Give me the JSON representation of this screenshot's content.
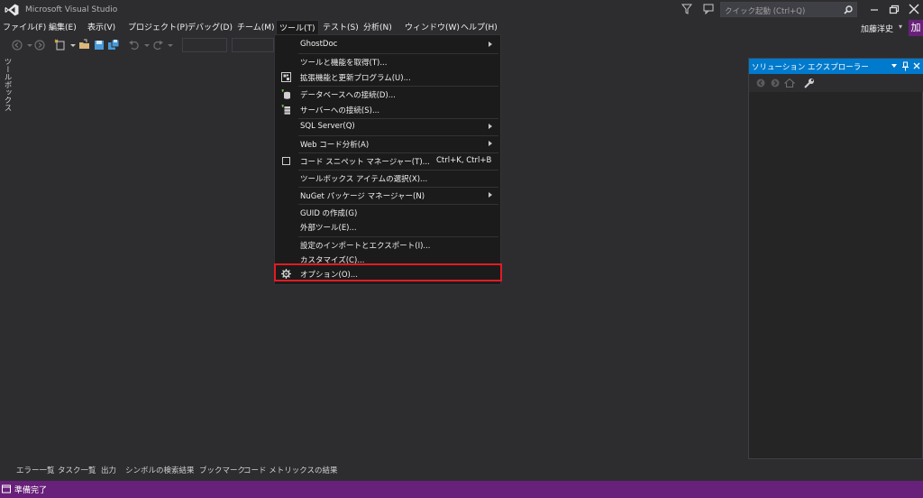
{
  "window": {
    "title": "Microsoft Visual Studio",
    "quick_launch_placeholder": "クイック起動 (Ctrl+Q)",
    "user_name": "加藤洋史",
    "user_initial": "加"
  },
  "menubar": {
    "items": [
      {
        "label": "ファイル(F)"
      },
      {
        "label": "編集(E)"
      },
      {
        "label": "表示(V)"
      },
      {
        "label": "プロジェクト(P)"
      },
      {
        "label": "デバッグ(D)"
      },
      {
        "label": "チーム(M)"
      },
      {
        "label": "ツール(T)",
        "active": true
      },
      {
        "label": "テスト(S)"
      },
      {
        "label": "分析(N)"
      },
      {
        "label": "ウィンドウ(W)"
      },
      {
        "label": "ヘルプ(H)"
      }
    ]
  },
  "toolbox": {
    "label": "ツールボックス"
  },
  "tools_menu": {
    "items": [
      {
        "label": "GhostDoc",
        "submenu": true
      },
      {
        "label": "ツールと機能を取得(T)..."
      },
      {
        "label": "拡張機能と更新プログラム(U)...",
        "icon": "extensions-icon"
      },
      {
        "label": "データベースへの接続(D)...",
        "icon": "database-connect-icon"
      },
      {
        "label": "サーバーへの接続(S)...",
        "icon": "server-connect-icon"
      },
      {
        "label": "SQL Server(Q)",
        "submenu": true
      },
      {
        "label": "Web コード分析(A)",
        "submenu": true
      },
      {
        "label": "コード スニペット マネージャー(T)...",
        "shortcut": "Ctrl+K, Ctrl+B",
        "icon": "snippet-icon"
      },
      {
        "label": "ツールボックス アイテムの選択(X)..."
      },
      {
        "label": "NuGet パッケージ マネージャー(N)",
        "submenu": true
      },
      {
        "label": "GUID の作成(G)"
      },
      {
        "label": "外部ツール(E)..."
      },
      {
        "label": "設定のインポートとエクスポート(I)..."
      },
      {
        "label": "カスタマイズ(C)..."
      },
      {
        "label": "オプション(O)...",
        "icon": "gear-icon",
        "highlighted": true
      }
    ]
  },
  "solution_explorer": {
    "title": "ソリューション エクスプローラー"
  },
  "bottom_tabs": [
    {
      "label": "エラー一覧"
    },
    {
      "label": "タスク一覧"
    },
    {
      "label": "出力"
    },
    {
      "label": "シンボルの検索結果"
    },
    {
      "label": "ブックマーク"
    },
    {
      "label": "コード メトリックスの結果"
    }
  ],
  "status": {
    "text": "準備完了"
  },
  "colors": {
    "accent": "#007acc",
    "status_bar": "#68217a",
    "highlight_border": "#e31b23",
    "background": "#2d2d30",
    "menu_background": "#1b1b1c"
  }
}
